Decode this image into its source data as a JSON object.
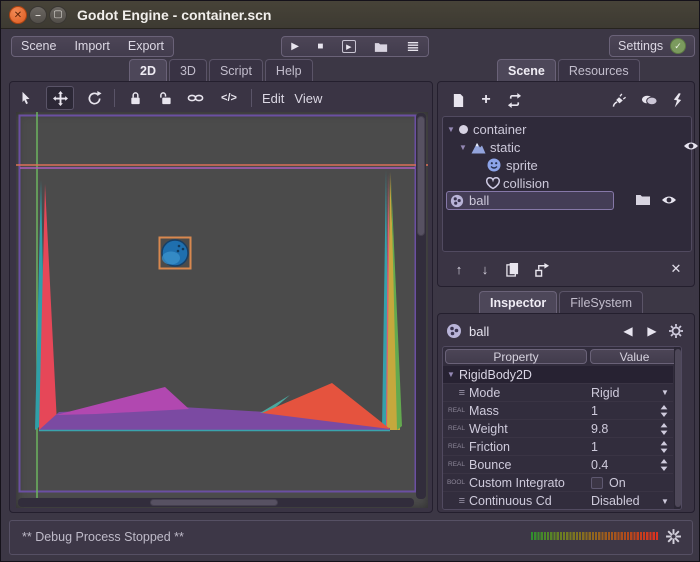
{
  "window": {
    "title": "Godot Engine - container.scn"
  },
  "menubar": {
    "menus": [
      {
        "label": "Scene"
      },
      {
        "label": "Import"
      },
      {
        "label": "Export"
      }
    ],
    "settings_label": "Settings"
  },
  "workspace_tabs": [
    {
      "label": "2D",
      "active": true
    },
    {
      "label": "3D",
      "active": false
    },
    {
      "label": "Script",
      "active": false
    },
    {
      "label": "Help",
      "active": false
    }
  ],
  "canvas_toolbar": {
    "edit_label": "Edit",
    "view_label": "View",
    "code_icon_label": "</>"
  },
  "scene_panel": {
    "tabs": [
      {
        "label": "Scene",
        "active": true
      },
      {
        "label": "Resources",
        "active": false
      }
    ],
    "tree": [
      {
        "name": "container",
        "icon": "node",
        "selected": false
      },
      {
        "name": "static",
        "icon": "static-body",
        "selected": false
      },
      {
        "name": "sprite",
        "icon": "sprite",
        "selected": false
      },
      {
        "name": "collision",
        "icon": "collision-polygon",
        "selected": false
      },
      {
        "name": "ball",
        "icon": "rigid-body",
        "selected": true
      }
    ]
  },
  "inspector_panel": {
    "tabs": [
      {
        "label": "Inspector",
        "active": true
      },
      {
        "label": "FileSystem",
        "active": false
      }
    ],
    "node_name": "ball",
    "columns": {
      "property": "Property",
      "value": "Value"
    },
    "category": "RigidBody2D",
    "rows": [
      {
        "tag": "",
        "label": "Mode",
        "value": "Rigid",
        "control": "dropdown"
      },
      {
        "tag": "REAL",
        "label": "Mass",
        "value": "1",
        "control": "spinner"
      },
      {
        "tag": "REAL",
        "label": "Weight",
        "value": "9.8",
        "control": "spinner"
      },
      {
        "tag": "REAL",
        "label": "Friction",
        "value": "1",
        "control": "spinner"
      },
      {
        "tag": "REAL",
        "label": "Bounce",
        "value": "0.4",
        "control": "spinner"
      },
      {
        "tag": "BOOL",
        "label": "Custom Integrato",
        "value": "On",
        "control": "checkbox"
      },
      {
        "tag": "",
        "label": "Continuous Cd",
        "value": "Disabled",
        "control": "dropdown"
      }
    ]
  },
  "statusbar": {
    "message": "** Debug Process Stopped **"
  },
  "colors": {
    "canvas_bg": "#4b4b4b",
    "viewport_border": "#6b4fa2",
    "axis_y_green": "#6fbb61",
    "axis_x_salmon": "#dd6f58",
    "scene_violet_line": "#ad5cbc",
    "selection_box": "#d8884f",
    "ball_fill": "#1f6fae",
    "polygon_magenta": "#b148b0",
    "polygon_floor_purple": "#7b4aa2",
    "polygon_red_left": "#e64758",
    "polygon_red_right": "#e5533e",
    "polygon_yellow": "#c5a83d",
    "polygon_teal": "#35a0aa",
    "polygon_green": "#63a94f"
  }
}
